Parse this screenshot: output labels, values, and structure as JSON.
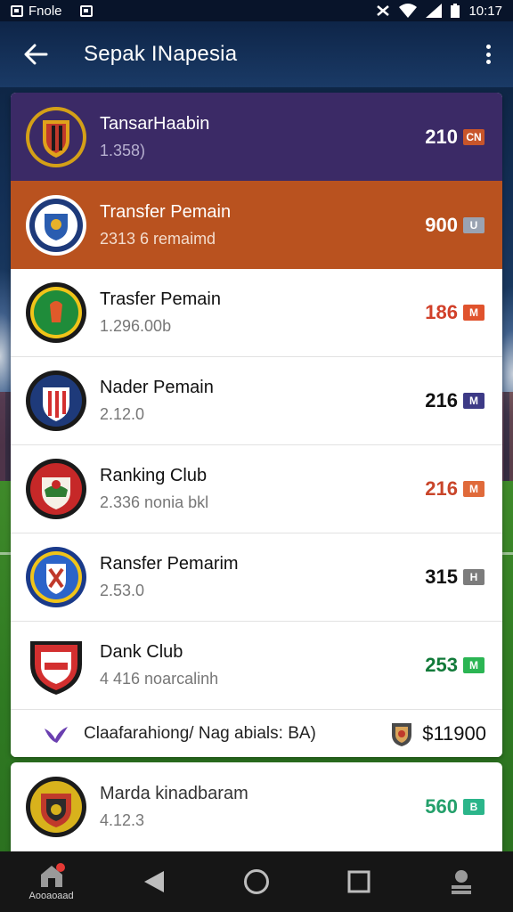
{
  "status_bar": {
    "app_label": "Fnole",
    "time": "10:17"
  },
  "app_bar": {
    "title": "Sepak INapesia"
  },
  "rows": [
    {
      "name": "TansarHaabin",
      "sub": "1.358)",
      "value": "210",
      "tag": "CN",
      "style": "dark",
      "value_color": "#ffffff",
      "tag_color": "#c8552a"
    },
    {
      "name": "Transfer Pemain",
      "sub": "2313 6 remaimd",
      "value": "900",
      "tag": "U",
      "style": "orange",
      "value_color": "#ffffff",
      "tag_color": "#9aa3b2"
    },
    {
      "name": "Trasfer Pemain",
      "sub": "1.296.00b",
      "value": "186",
      "tag": "M",
      "style": "white",
      "value_color": "#d1402a",
      "tag_color": "#e0532d"
    },
    {
      "name": "Nader Pemain",
      "sub": "2.12.0",
      "value": "216",
      "tag": "M",
      "style": "white",
      "value_color": "#111111",
      "tag_color": "#3d3a86"
    },
    {
      "name": "Ranking Club",
      "sub": "2.336 nonia bkl",
      "value": "216",
      "tag": "M",
      "style": "white",
      "value_color": "#c9452a",
      "tag_color": "#e06a3a"
    },
    {
      "name": "Ransfer Pemarim",
      "sub": "2.53.0",
      "value": "315",
      "tag": "H",
      "style": "white",
      "value_color": "#111111",
      "tag_color": "#7c7c7c"
    },
    {
      "name": "Dank Club",
      "sub": "4 416 noarcalinh",
      "value": "253",
      "tag": "M",
      "style": "white",
      "value_color": "#127a3a",
      "tag_color": "#2bb553"
    }
  ],
  "footer_row": {
    "text": "Claafarahiong/ Nag abials: BA)",
    "price": "$11900"
  },
  "card2": {
    "name": "Marda kinadbaram",
    "sub": "4.12.3",
    "value": "560",
    "tag": "B",
    "value_color": "#24a06b",
    "tag_color": "#2bb58a"
  },
  "nav": {
    "home_label": "Aooaoaad"
  },
  "colors": {
    "accent_dark": "#3b2a66",
    "accent_orange": "#b9521f"
  }
}
